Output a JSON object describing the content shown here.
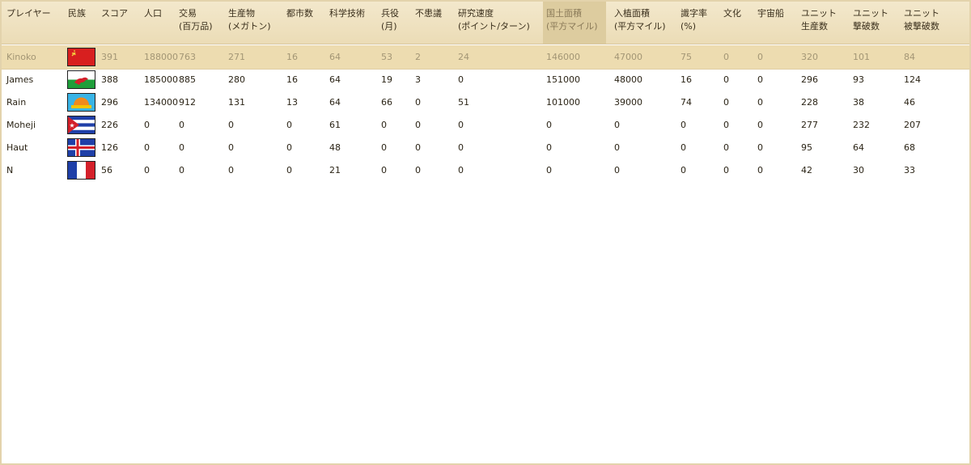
{
  "columns": [
    {
      "id": "player",
      "label1": "プレイヤー",
      "label2": ""
    },
    {
      "id": "civ",
      "label1": "民族",
      "label2": ""
    },
    {
      "id": "score",
      "label1": "スコア",
      "label2": ""
    },
    {
      "id": "pop",
      "label1": "人口",
      "label2": ""
    },
    {
      "id": "trade",
      "label1": "交易",
      "label2": "(百万品)"
    },
    {
      "id": "production",
      "label1": "生産物",
      "label2": "(メガトン)"
    },
    {
      "id": "cities",
      "label1": "都市数",
      "label2": ""
    },
    {
      "id": "tech",
      "label1": "科学技術",
      "label2": ""
    },
    {
      "id": "military",
      "label1": "兵役",
      "label2": "(月)"
    },
    {
      "id": "unrest",
      "label1": "不患議",
      "label2": ""
    },
    {
      "id": "research",
      "label1": "研究速度",
      "label2": "(ポイント/ターン)"
    },
    {
      "id": "land",
      "label1": "国土面積",
      "label2": "(平方マイル)"
    },
    {
      "id": "settled",
      "label1": "入植面積",
      "label2": "(平方マイル)"
    },
    {
      "id": "literacy",
      "label1": "識字率",
      "label2": "(%)"
    },
    {
      "id": "culture",
      "label1": "文化",
      "label2": ""
    },
    {
      "id": "spaceship",
      "label1": "宇宙船",
      "label2": ""
    },
    {
      "id": "units_built",
      "label1": "ユニット",
      "label2": "生産数"
    },
    {
      "id": "units_killed",
      "label1": "ユニット",
      "label2": "撃破数"
    },
    {
      "id": "units_lost",
      "label1": "ユニット",
      "label2": "被撃破数"
    }
  ],
  "sorted_column": "land",
  "rows": [
    {
      "player": "Kinoko",
      "flag": "ussr-flag",
      "cells": [
        "391",
        "188000",
        "763",
        "271",
        "16",
        "64",
        "53",
        "2",
        "24",
        "146000",
        "47000",
        "75",
        "0",
        "0",
        "320",
        "101",
        "84"
      ]
    },
    {
      "player": "James",
      "flag": "wales-flag",
      "cells": [
        "388",
        "185000",
        "885",
        "280",
        "16",
        "64",
        "19",
        "3",
        "0",
        "151000",
        "48000",
        "16",
        "0",
        "0",
        "296",
        "93",
        "124"
      ]
    },
    {
      "player": "Rain",
      "flag": "sunrise-flag",
      "cells": [
        "296",
        "134000",
        "912",
        "131",
        "13",
        "64",
        "66",
        "0",
        "51",
        "101000",
        "39000",
        "74",
        "0",
        "0",
        "228",
        "38",
        "46"
      ]
    },
    {
      "player": "Moheji",
      "flag": "cuba-flag",
      "cells": [
        "226",
        "0",
        "0",
        "0",
        "0",
        "61",
        "0",
        "0",
        "0",
        "0",
        "0",
        "0",
        "0",
        "0",
        "277",
        "232",
        "207"
      ]
    },
    {
      "player": "Haut",
      "flag": "iceland-flag",
      "cells": [
        "126",
        "0",
        "0",
        "0",
        "0",
        "48",
        "0",
        "0",
        "0",
        "0",
        "0",
        "0",
        "0",
        "0",
        "95",
        "64",
        "68"
      ]
    },
    {
      "player": "N",
      "flag": "france-flag",
      "cells": [
        "56",
        "0",
        "0",
        "0",
        "0",
        "21",
        "0",
        "0",
        "0",
        "0",
        "0",
        "0",
        "0",
        "0",
        "42",
        "30",
        "33"
      ]
    }
  ],
  "colors": {
    "header_bg": "#efe2c1",
    "selected_row_bg": "#eddcb0",
    "sorted_header_bg": "#ddcc9f"
  }
}
